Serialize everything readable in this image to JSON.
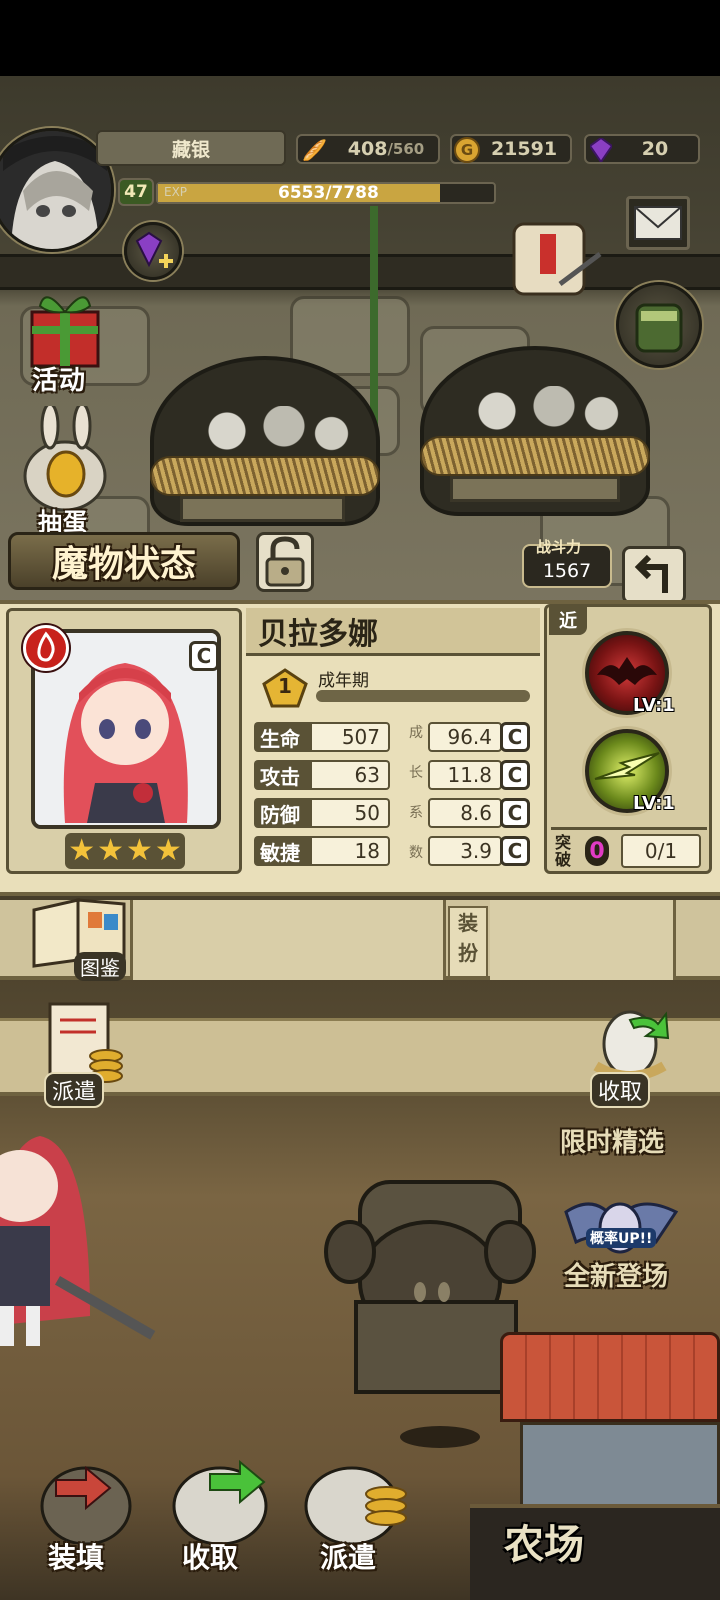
{
  "top": {
    "player_name": "藏银",
    "level": "47",
    "exp_label": "EXP",
    "exp_text": "6553/7788",
    "exp_progress": 0.84,
    "stamina_value": "408",
    "stamina_max": "/560",
    "gold_value": "21591",
    "gem_value": "20"
  },
  "side": {
    "activity_label": "活动",
    "cut_label": "抽蛋"
  },
  "monster": {
    "header_title": "魔物状态",
    "combat_label": "战斗力",
    "combat_value": "1567",
    "name": "贝拉多娜",
    "stage_number": "1",
    "stage_label": "成年期",
    "stars": 4,
    "range_tag": "近",
    "growth_label": [
      "成",
      "长",
      "系",
      "数"
    ],
    "stats": [
      {
        "label": "生命",
        "value": "507",
        "growth": "96.4",
        "grade": "C"
      },
      {
        "label": "攻击",
        "value": "63",
        "growth": "11.8",
        "grade": "C"
      },
      {
        "label": "防御",
        "value": "50",
        "growth": "8.6",
        "grade": "C"
      },
      {
        "label": "敏捷",
        "value": "18",
        "growth": "3.9",
        "grade": "C"
      }
    ],
    "skills": [
      {
        "name": "dark-bat-skill",
        "level": "LV:1"
      },
      {
        "name": "lightning-skill",
        "level": "LV:1"
      }
    ],
    "breakthrough_label": [
      "突",
      "破"
    ],
    "breakthrough_count": "0",
    "breakthrough_progress": "0/1"
  },
  "midbar": {
    "codex_label": "图鉴",
    "dress_label": [
      "装",
      "扮"
    ],
    "dispatch_label": "派遣",
    "collect_label": "收取"
  },
  "right_events": {
    "limited_label": "限时精选",
    "rate_up_label": "概率UP!!",
    "new_label": "全新登场"
  },
  "bottom_nav": {
    "load_label": "装填",
    "collect_label": "收取",
    "dispatch_label": "派遣",
    "farm_label": "农场"
  },
  "colors": {
    "panel_bg": "#e9dfba",
    "fire_badge": "#c8221c",
    "breakthrough_pink": "#e13bc4",
    "star": "#f3c23a"
  }
}
